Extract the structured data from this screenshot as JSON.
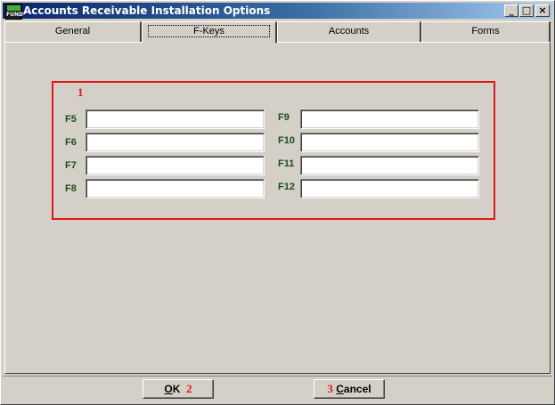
{
  "window": {
    "title": "Accounts Receivable Installation Options",
    "app_icon_text": "FUND",
    "minimize_glyph": "_",
    "maximize_glyph": "□",
    "close_glyph": "×"
  },
  "tabs": [
    {
      "label": "General"
    },
    {
      "label": "F-Keys"
    },
    {
      "label": "Accounts"
    },
    {
      "label": "Forms"
    }
  ],
  "fkeys": {
    "marker": "1",
    "left": [
      {
        "label": "F5",
        "value": ""
      },
      {
        "label": "F6",
        "value": ""
      },
      {
        "label": "F7",
        "value": ""
      },
      {
        "label": "F8",
        "value": ""
      }
    ],
    "right": [
      {
        "label": "F9",
        "value": ""
      },
      {
        "label": "F10",
        "value": ""
      },
      {
        "label": "F11",
        "value": ""
      },
      {
        "label": "F12",
        "value": ""
      }
    ]
  },
  "buttons": {
    "ok_mnemonic": "O",
    "ok_rest": "K",
    "ok_marker": "2",
    "cancel_marker": "3",
    "cancel_mnemonic": "C",
    "cancel_rest": "ancel"
  },
  "colors": {
    "title_gradient_start": "#0a246a",
    "marker_red": "#e01818",
    "label_green": "#1e4a1e",
    "face": "#d4d0c8"
  }
}
